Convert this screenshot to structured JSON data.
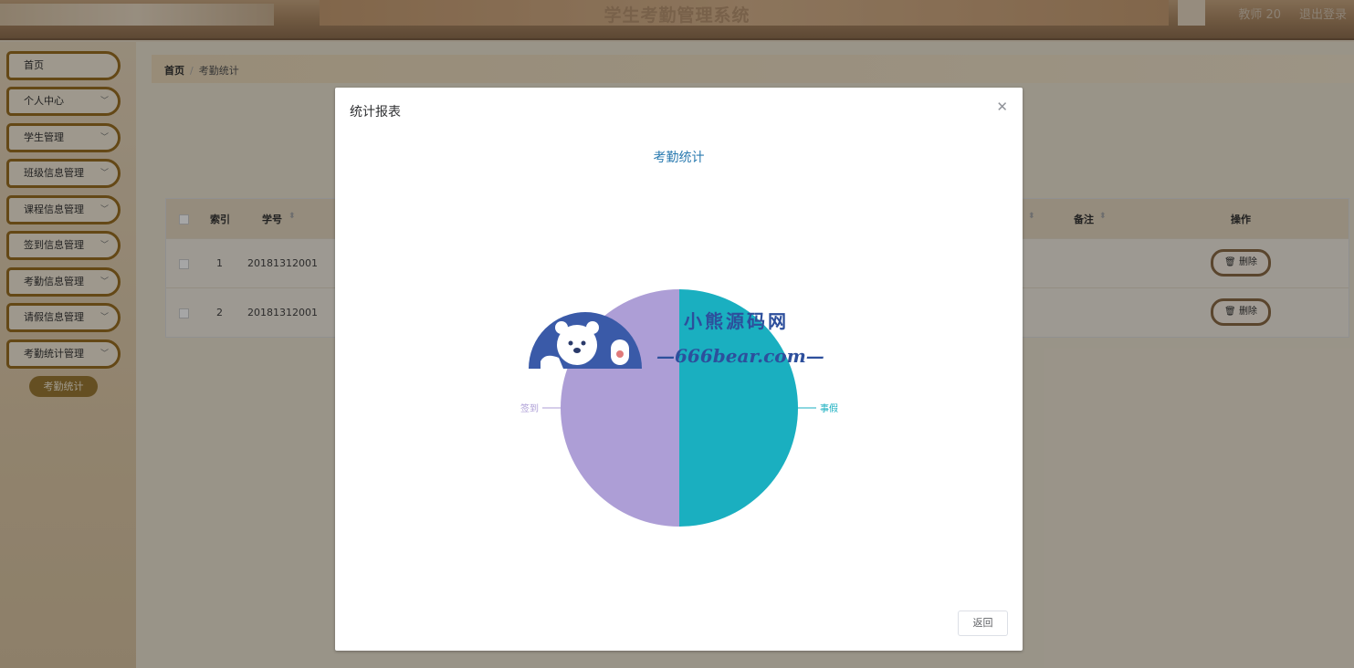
{
  "header": {
    "title": "学生考勤管理系统",
    "user": "教师 20",
    "logout": "退出登录"
  },
  "sidebar": {
    "items": [
      {
        "label": "首页",
        "has_children": false
      },
      {
        "label": "个人中心",
        "has_children": true
      },
      {
        "label": "学生管理",
        "has_children": true
      },
      {
        "label": "班级信息管理",
        "has_children": true
      },
      {
        "label": "课程信息管理",
        "has_children": true
      },
      {
        "label": "签到信息管理",
        "has_children": true
      },
      {
        "label": "考勤信息管理",
        "has_children": true
      },
      {
        "label": "请假信息管理",
        "has_children": true
      },
      {
        "label": "考勤统计管理",
        "has_children": true
      }
    ],
    "active_sub": "考勤统计"
  },
  "breadcrumb": {
    "home": "首页",
    "current": "考勤统计"
  },
  "table": {
    "headers": [
      "索引",
      "学号",
      "备注",
      "操作"
    ],
    "rows": [
      {
        "index": "1",
        "student_id": "20181312001",
        "action": "删除"
      },
      {
        "index": "2",
        "student_id": "20181312001",
        "action": "删除"
      }
    ]
  },
  "dialog": {
    "title": "统计报表",
    "back_label": "返回"
  },
  "watermark": {
    "line1": "小熊源码网",
    "line2": "—666bear.com—"
  },
  "colors": {
    "slice_signin": "#ad9ed6",
    "slice_leave": "#1aafc0"
  },
  "chart_data": {
    "type": "pie",
    "title": "考勤统计",
    "categories": [
      "签到",
      "事假"
    ],
    "values": [
      1,
      1
    ],
    "legend": "none"
  }
}
